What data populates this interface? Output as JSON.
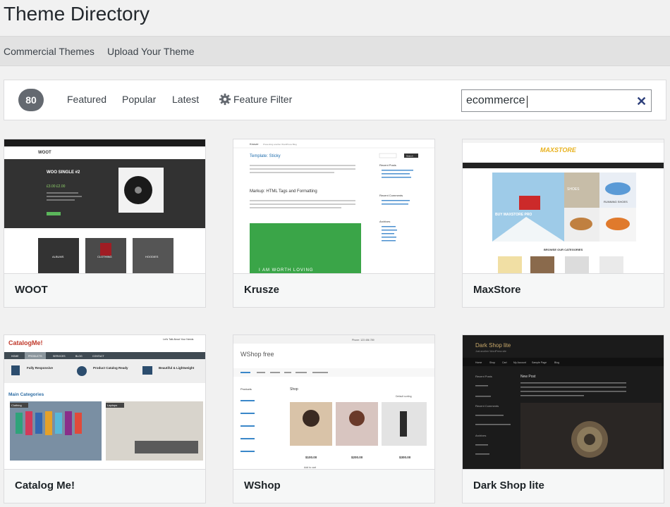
{
  "page": {
    "title": "Theme Directory"
  },
  "subnav": {
    "commercial": "Commercial Themes",
    "upload": "Upload Your Theme"
  },
  "filters": {
    "count": "80",
    "featured": "Featured",
    "popular": "Popular",
    "latest": "Latest",
    "feature_filter": "Feature Filter"
  },
  "search": {
    "value": "ecommerce",
    "clear": "✕"
  },
  "themes": [
    {
      "name": "WOOT",
      "shot": {
        "brand": "WOOT",
        "hero": "WOO SINGLE #2",
        "price": "£3.00 £2.00",
        "cats": [
          "ALBUMS",
          "CLOTHING",
          "HOODIES"
        ]
      }
    },
    {
      "name": "Krusze",
      "shot": {
        "brand": "Krusze",
        "tagline": "Presenting another WordPress Blog",
        "post1": "Template: Sticky",
        "post2": "Markup: HTML Tags and Formatting",
        "banner": "I AM WORTH LOVING",
        "w1": "Recent Posts",
        "w2": "Recent Comments",
        "w3": "Archives",
        "search": "Search"
      }
    },
    {
      "name": "MaxStore",
      "shot": {
        "brand": "MAXSTORE",
        "promo": "BUY MAXSTORE PRO",
        "shoes": "SHOES",
        "running": "RUNNING SHOES",
        "categories": "BROWSE OUR CATEGORIES"
      }
    },
    {
      "name": "Catalog Me!",
      "shot": {
        "brand": "CatalogMe!",
        "talk": "Let's Talk About Your Needs",
        "nav": [
          "HOME",
          "PRODUCTS",
          "SERVICES",
          "BLOG",
          "CONTACT"
        ],
        "f1": "Fully Responsive",
        "f2": "Product Catalog Ready",
        "f3": "Beautiful & Lightweight",
        "main": "Main Categories",
        "c1": "Clothing",
        "c2": "Laptops"
      }
    },
    {
      "name": "WShop",
      "shot": {
        "brand": "WShop free",
        "phone": "Phone: 123 456 789",
        "shop": "Shop",
        "products": "Products",
        "sorting": "Default sorting",
        "p1": "$100.00",
        "p2": "$200.00",
        "p3": "$300.00",
        "add": "Add to cart"
      }
    },
    {
      "name": "Dark Shop lite",
      "shot": {
        "brand": "Dark Shop lite",
        "tagline": "Just another WordPress site",
        "nav": [
          "Home",
          "Shop",
          "Cart",
          "My Account",
          "Sample Page",
          "Blog"
        ],
        "post": "New Post",
        "recent": "Recent Posts",
        "comments": "Recent Comments",
        "archives": "Archives"
      }
    }
  ]
}
